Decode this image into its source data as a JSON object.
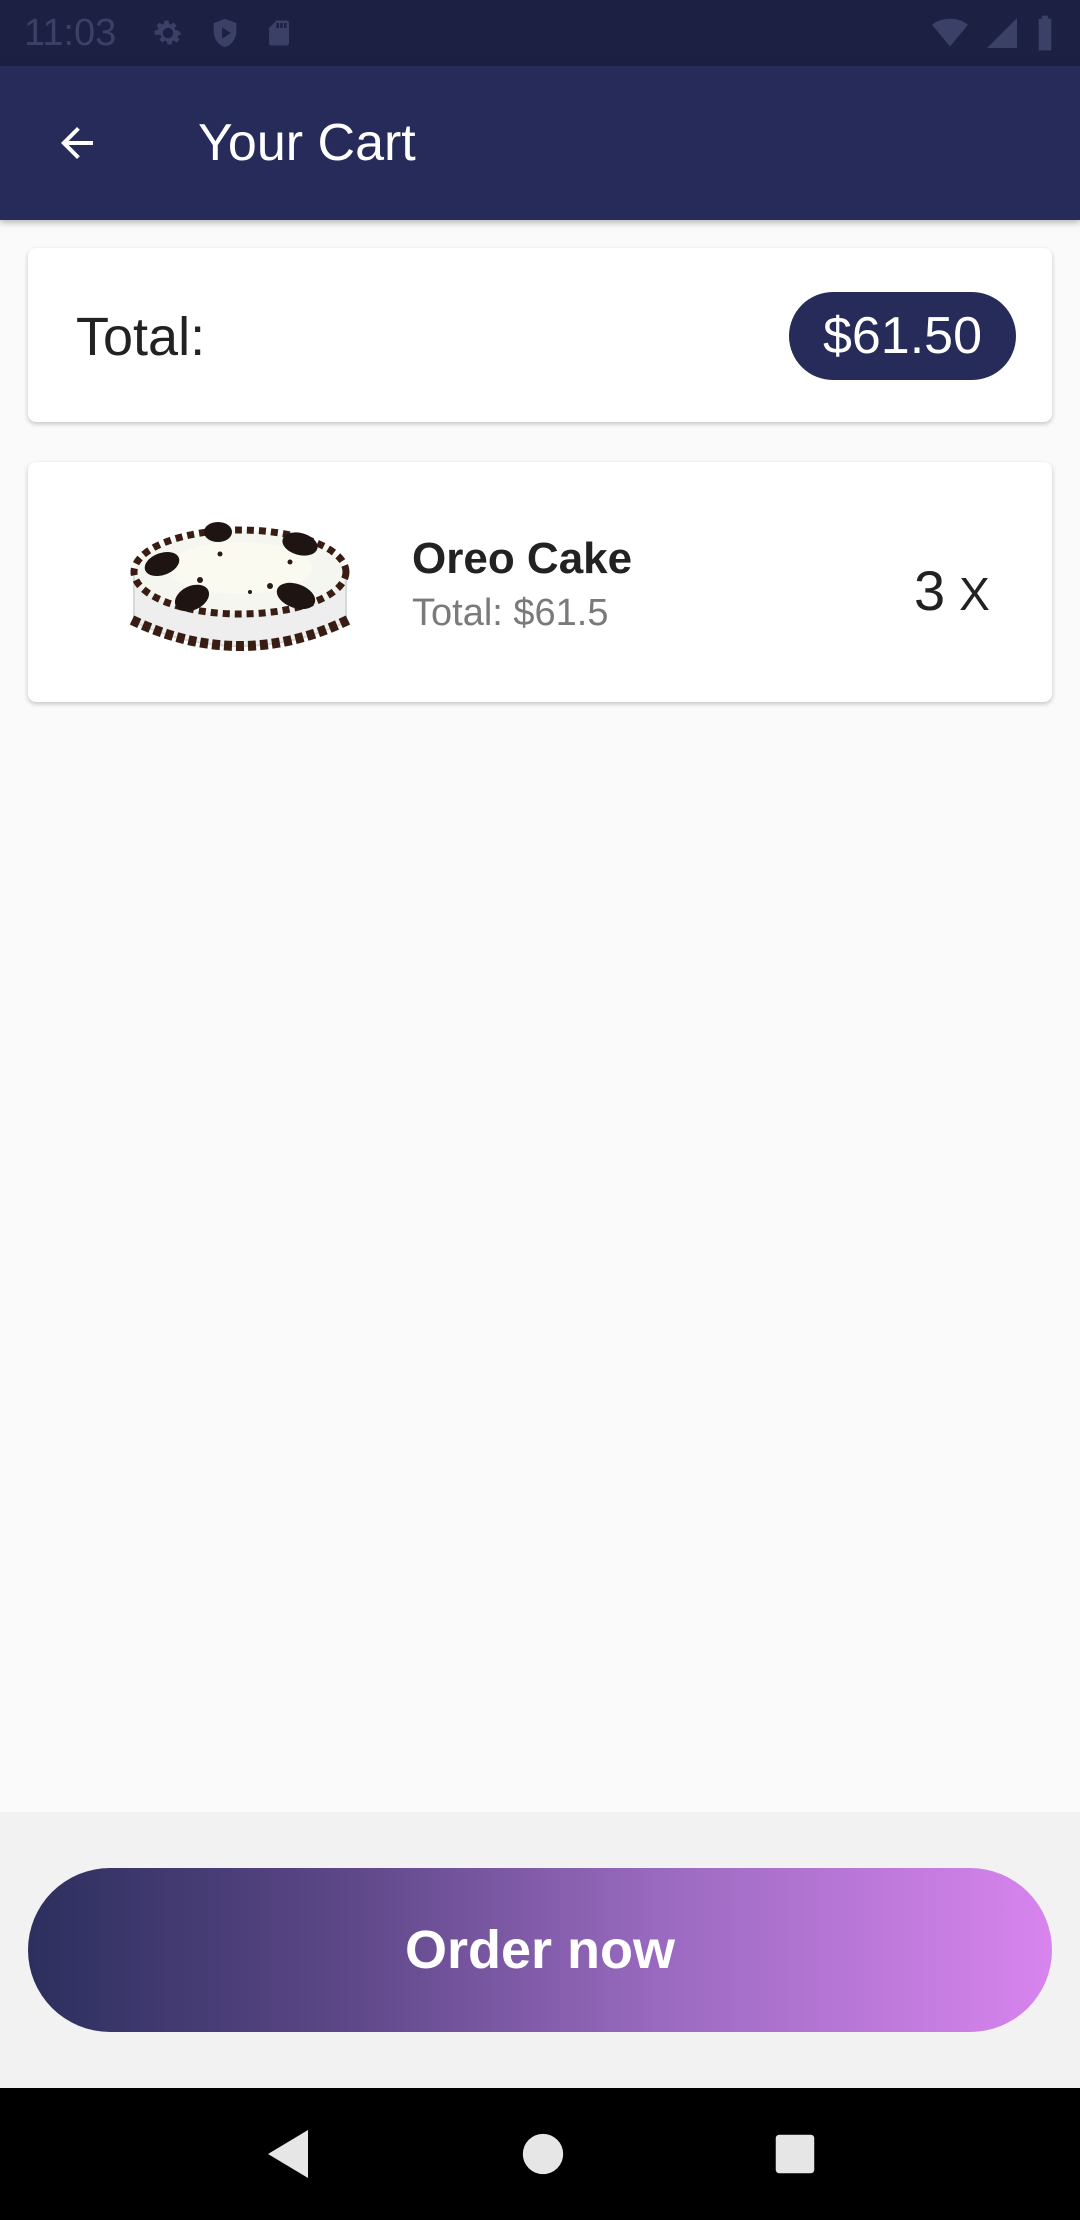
{
  "status_bar": {
    "time": "11:03",
    "icons": [
      "gear-icon",
      "shield-icon",
      "sd-card-icon",
      "wifi-icon",
      "signal-icon",
      "battery-icon"
    ]
  },
  "app_bar": {
    "title": "Your Cart",
    "back_icon": "arrow-left-icon"
  },
  "total_card": {
    "label": "Total:",
    "amount": "$61.50"
  },
  "cart_items": [
    {
      "name": "Oreo Cake",
      "total": "Total: $61.5",
      "quantity": "3",
      "quantity_suffix": "X"
    }
  ],
  "order_button": {
    "label": "Order now"
  },
  "colors": {
    "primary": "#262b5a",
    "gradient_start": "#2c2f5e",
    "gradient_end": "#d884ee"
  }
}
